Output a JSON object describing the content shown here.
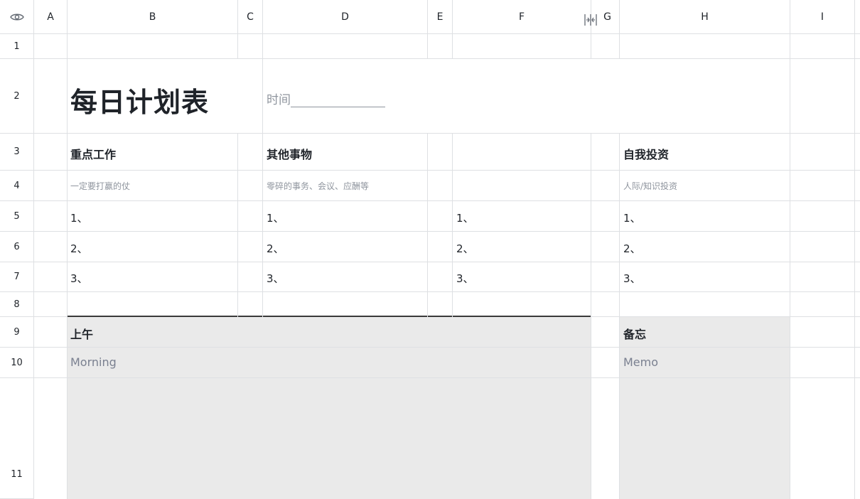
{
  "columns": [
    "A",
    "B",
    "C",
    "D",
    "E",
    "F",
    "G",
    "H",
    "I"
  ],
  "rows": [
    "1",
    "2",
    "3",
    "4",
    "5",
    "6",
    "7",
    "8",
    "9",
    "10",
    "11"
  ],
  "title": "每日计划表",
  "time_label": "时间",
  "sections": {
    "key_work": {
      "heading": "重点工作",
      "hint": "一定要打赢的仗"
    },
    "other": {
      "heading": "其他事物",
      "hint": "零碎的事务、会议、应酬等"
    },
    "self_invest": {
      "heading": "自我投资",
      "hint": "人际/知识投资"
    }
  },
  "items": [
    "1、",
    "2、",
    "3、"
  ],
  "morning": {
    "heading": "上午",
    "sub": "Morning"
  },
  "memo": {
    "heading": "备忘",
    "sub": "Memo"
  },
  "colors": {
    "grid": "#dee0e3",
    "fill": "#eaeaea",
    "placeholder": "#8f959e",
    "sub_text": "#6b7280"
  }
}
